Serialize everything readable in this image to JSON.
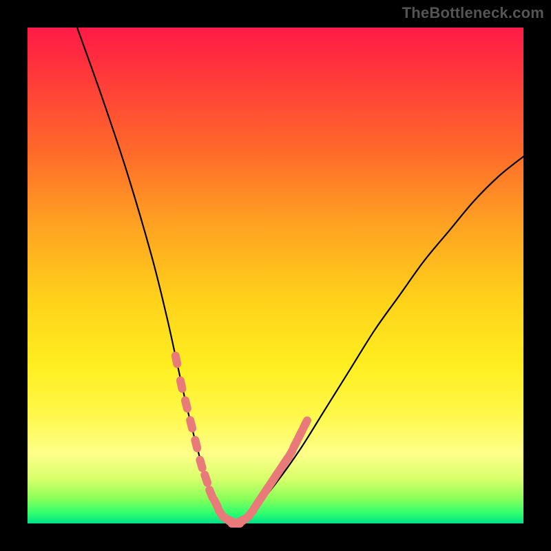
{
  "watermark": "TheBottleneck.com",
  "chart_data": {
    "type": "line",
    "title": "",
    "xlabel": "",
    "ylabel": "",
    "xlim": [
      0,
      100
    ],
    "ylim": [
      0,
      100
    ],
    "grid": false,
    "legend": false,
    "series": [
      {
        "name": "bottleneck-curve",
        "x": [
          10,
          15,
          20,
          25,
          28,
          30,
          32,
          34,
          36,
          38,
          40,
          42,
          45,
          50,
          55,
          60,
          65,
          70,
          75,
          80,
          85,
          90,
          95,
          100
        ],
        "y": [
          100,
          86,
          71,
          54,
          42,
          33,
          24,
          16,
          9,
          4,
          1,
          0,
          2,
          8,
          15,
          23,
          31,
          39,
          46,
          53,
          59,
          65,
          70,
          74
        ],
        "color": "#000000"
      }
    ],
    "markers": [
      {
        "name": "highlighted-points",
        "x": [
          30,
          31,
          32,
          33,
          34,
          35,
          36,
          37,
          38,
          39,
          40,
          41,
          42,
          43,
          44,
          45,
          46,
          47,
          48,
          49,
          50,
          51,
          52,
          53,
          54,
          55,
          56
        ],
        "y": [
          33,
          28,
          24,
          20,
          16,
          12,
          9,
          6,
          4,
          2,
          1,
          0.5,
          0,
          0.5,
          1,
          2,
          3.5,
          5,
          6.5,
          8,
          9.5,
          11,
          12.5,
          14,
          16,
          18,
          20
        ],
        "color": "#e97a7a",
        "shape": "rounded-bar"
      }
    ],
    "background_gradient": {
      "orientation": "vertical",
      "stops": [
        {
          "pos": 0.0,
          "color": "#ff1a47"
        },
        {
          "pos": 0.55,
          "color": "#ffd21a"
        },
        {
          "pos": 0.86,
          "color": "#fdff8a"
        },
        {
          "pos": 1.0,
          "color": "#00e08a"
        }
      ]
    }
  }
}
